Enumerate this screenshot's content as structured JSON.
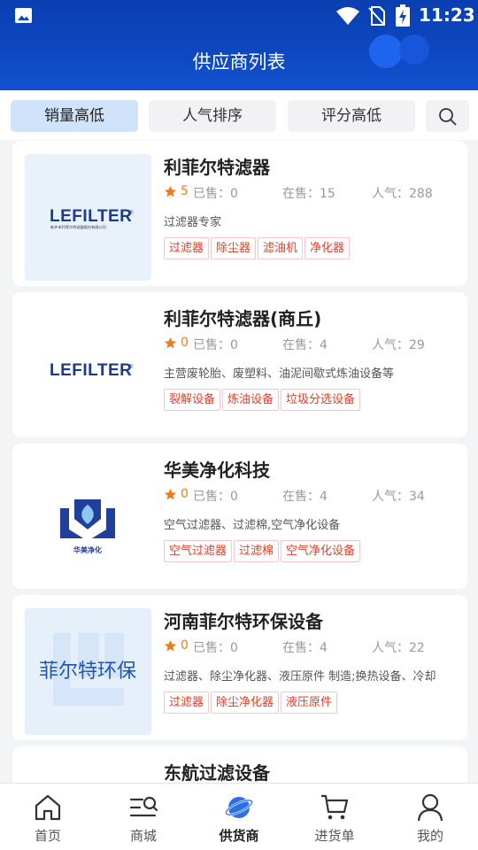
{
  "status_bar": {
    "time": "11:23"
  },
  "header": {
    "title": "供应商列表"
  },
  "filters": {
    "tabs": [
      "销量高低",
      "人气排序",
      "评分高低"
    ],
    "active_index": 0
  },
  "labels": {
    "sold": "已售：",
    "on_sale": "在售：",
    "popularity": "人气："
  },
  "suppliers": [
    {
      "name": "利菲尔特滤器",
      "rating": "5",
      "sold": "0",
      "on_sale": "15",
      "popularity": "288",
      "description": "过滤器专家",
      "tags": [
        "过滤器",
        "除尘器",
        "滤油机",
        "净化器"
      ],
      "logo": {
        "wordmark": "LEFILTER",
        "subtitle": "新乡市利菲尔特滤器股份有限公司",
        "bg": "#e9f1fb"
      }
    },
    {
      "name": "利菲尔特滤器(商丘)",
      "rating": "0",
      "sold": "0",
      "on_sale": "4",
      "popularity": "29",
      "description": "主营废轮胎、废塑料、油泥间歇式炼油设备等",
      "tags": [
        "裂解设备",
        "炼油设备",
        "垃圾分选设备"
      ],
      "logo": {
        "wordmark": "LEFILTER",
        "bg": "#ffffff"
      }
    },
    {
      "name": "华美净化科技",
      "rating": "0",
      "sold": "0",
      "on_sale": "4",
      "popularity": "34",
      "description": "空气过滤器、过滤棉,空气净化设备",
      "tags": [
        "空气过滤器",
        "过滤棉",
        "空气净化设备"
      ],
      "logo": {
        "wordmark": "华美净化",
        "bg": "#ffffff"
      }
    },
    {
      "name": "河南菲尔特环保设备",
      "rating": "0",
      "sold": "0",
      "on_sale": "4",
      "popularity": "22",
      "description": "过滤器、除尘净化器、液压原件 制造;换热设备、冷却",
      "tags": [
        "过滤器",
        "除尘净化器",
        "液压原件"
      ],
      "logo": {
        "wordmark": "菲尔特环保",
        "bg": "#e6f0fb"
      }
    },
    {
      "name": "东航过滤设备",
      "rating": "",
      "sold": "",
      "on_sale": "",
      "popularity": "",
      "description": "",
      "tags": [],
      "logo": {
        "wordmark": "",
        "bg": "#ffffff"
      }
    }
  ],
  "bottom_nav": {
    "items": [
      {
        "label": "首页",
        "icon": "home-icon"
      },
      {
        "label": "商城",
        "icon": "store-search-icon"
      },
      {
        "label": "供货商",
        "icon": "supplier-planet-icon"
      },
      {
        "label": "进货单",
        "icon": "cart-icon"
      },
      {
        "label": "我的",
        "icon": "profile-icon"
      }
    ],
    "active_index": 2
  },
  "colors": {
    "header": "#0d47c0",
    "active_tab": "#cfe4fb",
    "tag_text": "#e0412b",
    "star": "#f07c1a",
    "nav_active": "#2a6fe8"
  }
}
